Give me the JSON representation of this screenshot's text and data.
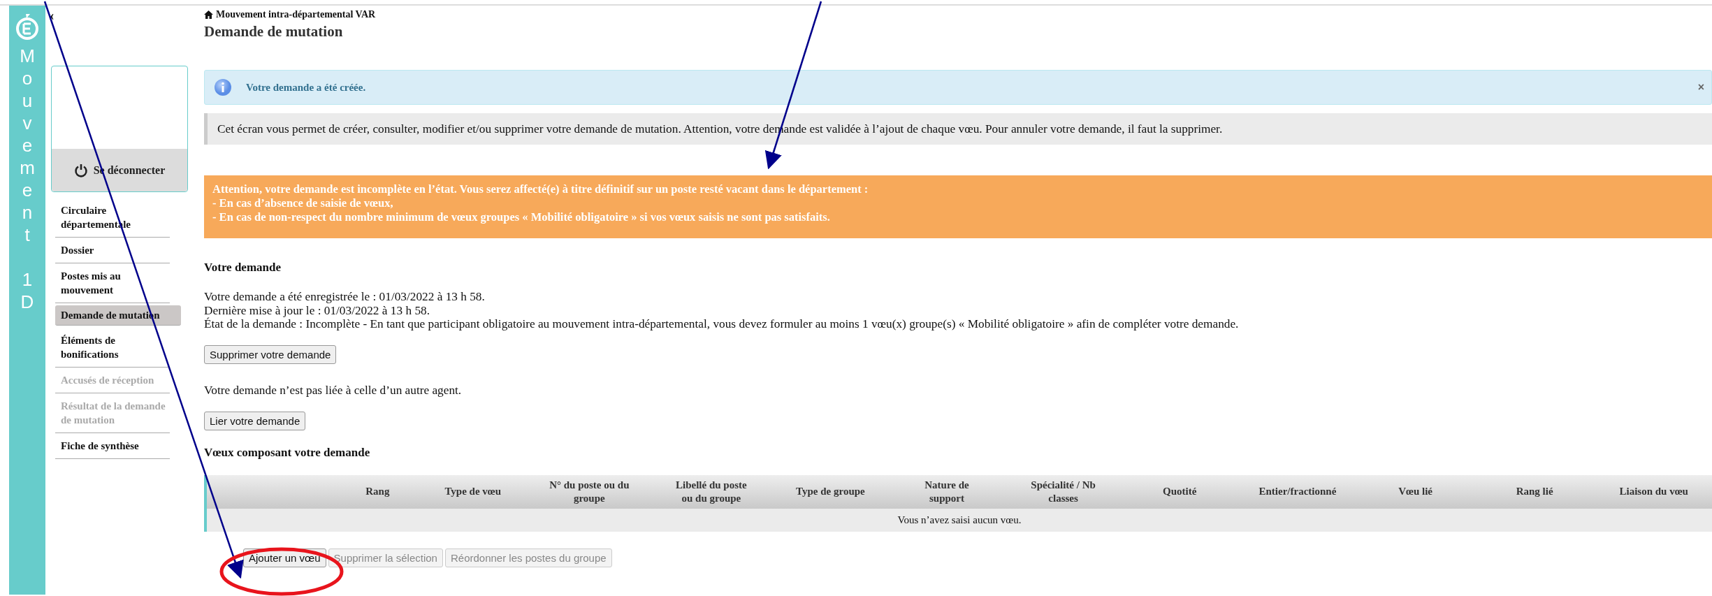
{
  "app_bar": {
    "words": [
      [
        "M",
        "o",
        "u",
        "v",
        "e",
        "m",
        "e",
        "n",
        "t"
      ],
      [
        "1",
        "D"
      ]
    ]
  },
  "sidebar": {
    "collapse": "‹",
    "logout": "Se déconnecter",
    "items": [
      {
        "label": "Circulaire départementale",
        "selected": false,
        "disabled": false
      },
      {
        "label": "Dossier",
        "selected": false,
        "disabled": false
      },
      {
        "label": "Postes mis au mouvement",
        "selected": false,
        "disabled": false
      },
      {
        "label": "Demande de mutation",
        "selected": true,
        "disabled": false
      },
      {
        "label": "Éléments de bonifications",
        "selected": false,
        "disabled": false
      },
      {
        "label": "Accusés de réception",
        "selected": false,
        "disabled": true
      },
      {
        "label": "Résultat de la demande de mutation",
        "selected": false,
        "disabled": true
      },
      {
        "label": "Fiche de synthèse",
        "selected": false,
        "disabled": false
      }
    ]
  },
  "breadcrumb": "Mouvement intra-départemental VAR",
  "title": "Demande de mutation",
  "info_alert": {
    "text": "Votre demande a été créée.",
    "close": "×"
  },
  "note": "Cet écran vous permet de créer, consulter, modifier et/ou supprimer votre demande de mutation. Attention, votre demande est validée à l’ajout de chaque vœu. Pour annuler votre demande, il faut la supprimer.",
  "warning": [
    "Attention, votre demande est incomplète en l’état. Vous serez affecté(e) à titre définitif sur un poste resté vacant dans le département :",
    "- En cas d’absence de saisie de vœux,",
    "- En cas de non-respect du nombre minimum de vœux groupes « Mobilité obligatoire » si vos vœux saisis ne sont pas satisfaits."
  ],
  "request": {
    "heading": "Votre demande",
    "lines": [
      "Votre demande a été enregistrée le : 01/03/2022 à 13 h 58.",
      "Dernière mise à jour le : 01/03/2022 à 13 h 58.",
      "État de la demande : Incomplète - En tant que participant obligatoire au mouvement intra-départemental, vous devez formuler au moins 1 vœu(x) groupe(s) « Mobilité obligatoire » afin de compléter votre demande."
    ],
    "delete_button": "Supprimer votre demande",
    "link_text": "Votre demande n’est pas liée à celle d’un autre agent.",
    "link_button": "Lier votre demande"
  },
  "wishes": {
    "heading": "Vœux composant votre demande",
    "columns": [
      "Rang",
      "Type de vœu",
      "N° du poste ou du groupe",
      "Libellé du poste ou du groupe",
      "Type de groupe",
      "Nature de support",
      "Spécialité / Nb classes",
      "Quotité",
      "Entier/fractionné",
      "Vœu lié",
      "Rang lié",
      "Liaison du vœu"
    ],
    "empty": "Vous n’avez saisi aucun vœu.",
    "buttons": [
      {
        "label": "Ajouter un vœu",
        "disabled": false
      },
      {
        "label": "Supprimer la sélection",
        "disabled": true
      },
      {
        "label": "Réordonner les postes du groupe",
        "disabled": true
      }
    ]
  }
}
